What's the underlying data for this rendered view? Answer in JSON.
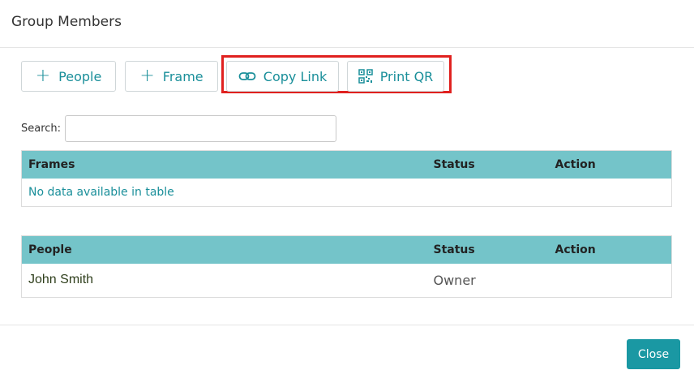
{
  "modal": {
    "title": "Group Members"
  },
  "toolbar": {
    "people_label": "People",
    "frame_label": "Frame",
    "copy_link_label": "Copy Link",
    "print_qr_label": "Print QR"
  },
  "search": {
    "label": "Search:",
    "value": ""
  },
  "frames_table": {
    "headers": [
      "Frames",
      "Status",
      "Action"
    ],
    "empty_message": "No data available in table"
  },
  "people_table": {
    "headers": [
      "People",
      "Status",
      "Action"
    ],
    "rows": [
      {
        "name": "John Smith",
        "status": "Owner",
        "action": ""
      }
    ]
  },
  "footer": {
    "close_label": "Close"
  },
  "colors": {
    "accent": "#1a8f9a",
    "table_header": "#74c4c9",
    "highlight": "#e0211f",
    "close_button": "#1a98a3"
  }
}
